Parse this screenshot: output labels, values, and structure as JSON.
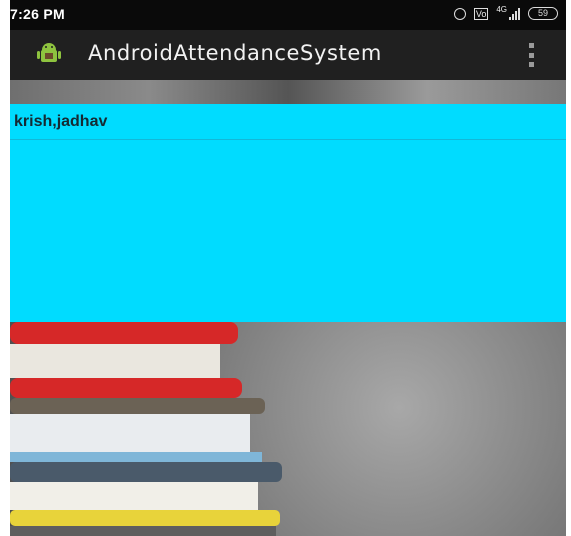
{
  "status_bar": {
    "time": "7:26 PM",
    "icons": [
      "alarm-icon",
      "vo-lte-icon",
      "signal-4g-icon",
      "battery-icon"
    ],
    "network_label": "4G",
    "battery_level": "59"
  },
  "action_bar": {
    "app_icon": "android-icon",
    "title": "AndroidAttendanceSystem",
    "overflow_icon": "overflow-menu-icon"
  },
  "list": {
    "items": [
      {
        "label": "krish,jadhav"
      }
    ]
  },
  "colors": {
    "status_bar_bg": "#0a0a0a",
    "action_bar_bg": "#202020",
    "list_bg": "#00dcff",
    "book_red": "#d62828",
    "book_yellow": "#e8d33a"
  }
}
